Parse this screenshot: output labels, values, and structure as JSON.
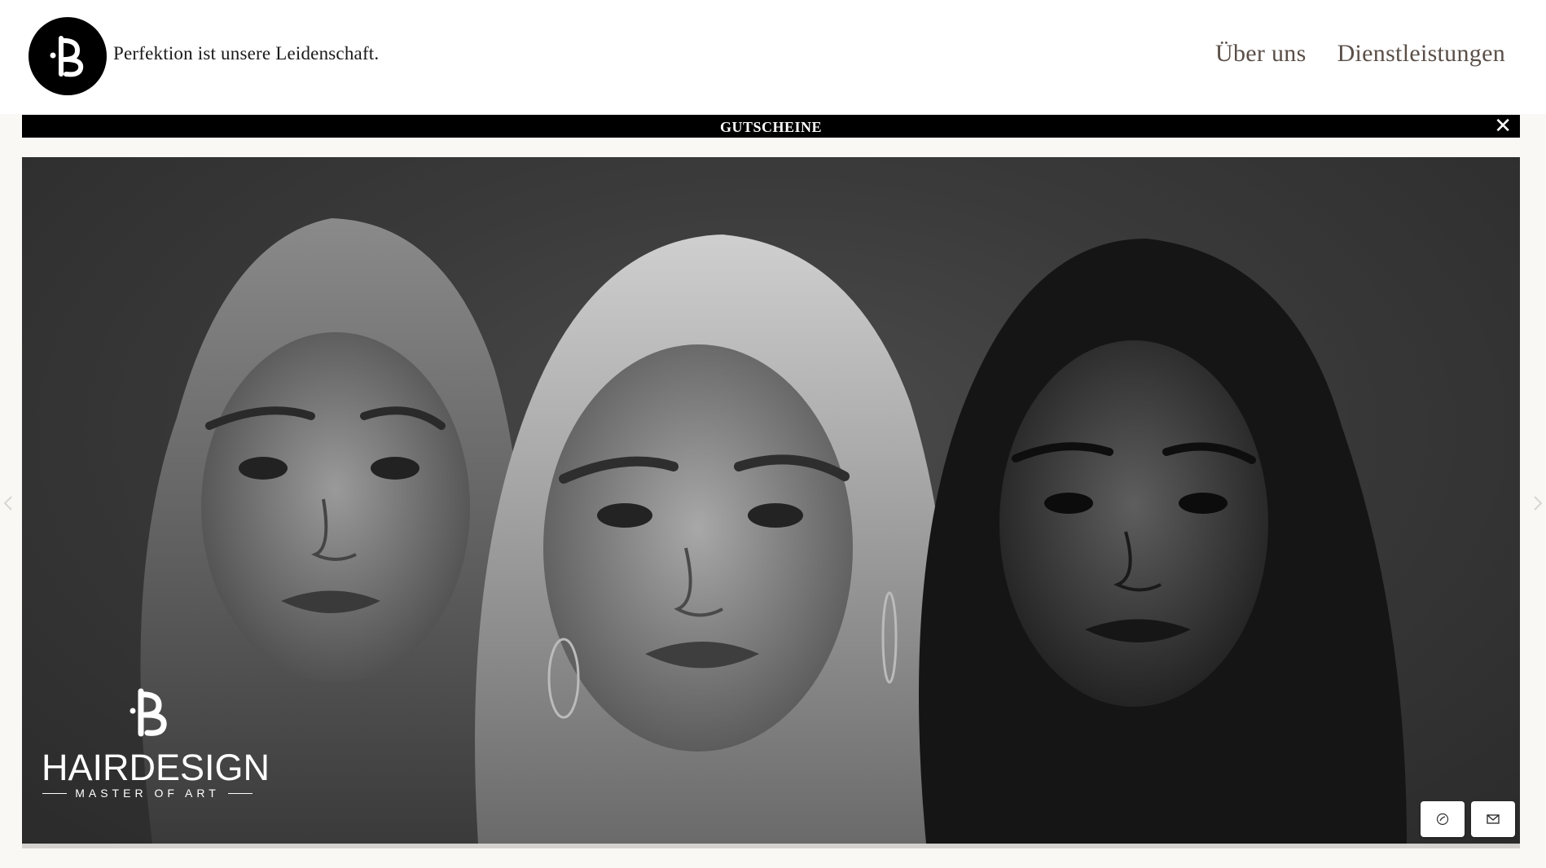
{
  "header": {
    "tagline": "Perfektion ist unsere Leidenschaft.",
    "logo_icon": "pb-monogram-icon",
    "nav": [
      {
        "label": "Über uns"
      },
      {
        "label": "Dienstleistungen"
      }
    ]
  },
  "voucher_bar": {
    "label": "GUTSCHEINE",
    "close_symbol": "✕"
  },
  "hero": {
    "brand_name": "HAIRDESIGN",
    "brand_sub": "MASTER OF ART",
    "contact_buttons": [
      {
        "icon": "phone-icon"
      },
      {
        "icon": "mail-icon"
      }
    ]
  },
  "colors": {
    "bar": "#000000",
    "background": "#faf8f4",
    "nav_text": "#5a4f48"
  }
}
